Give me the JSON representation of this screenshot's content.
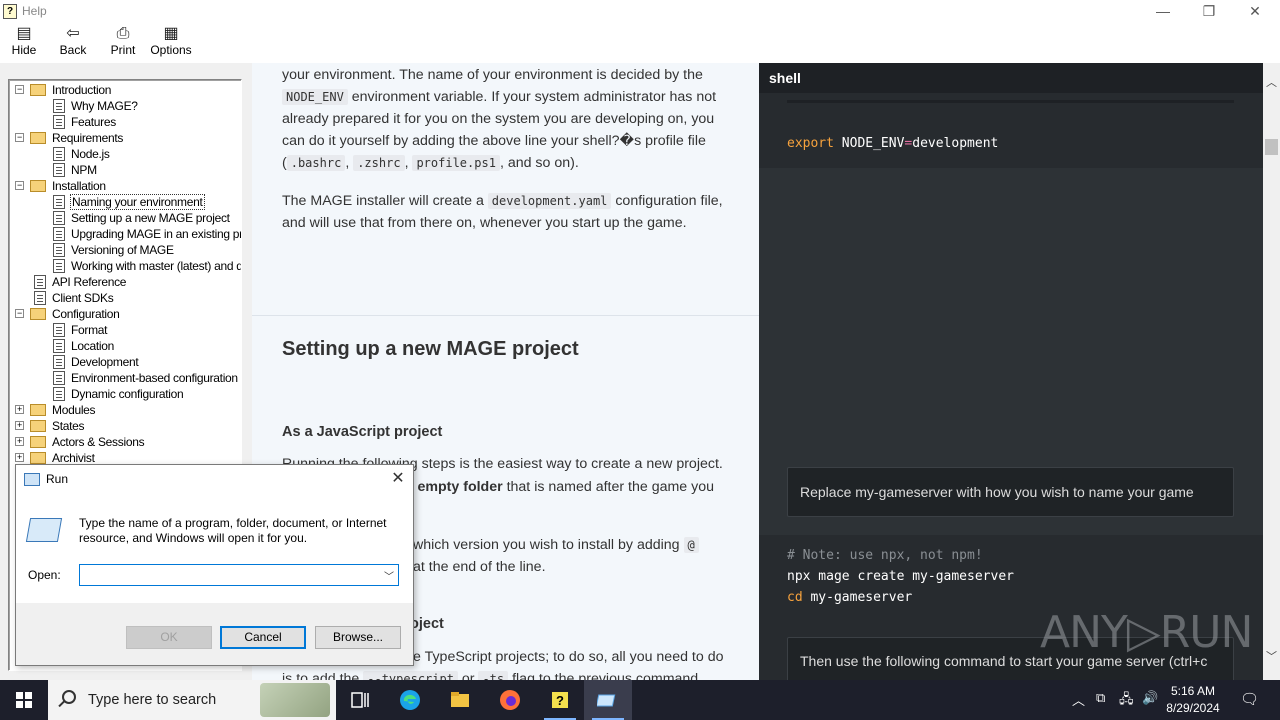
{
  "window": {
    "title": "Help",
    "minimize": "—",
    "maximize": "❐",
    "close": "✕"
  },
  "toolbar": {
    "hide": "Hide",
    "back": "Back",
    "print": "Print",
    "options": "Options"
  },
  "tree": [
    {
      "label": "Introduction",
      "kind": "folder",
      "level": 0,
      "expander": "−"
    },
    {
      "label": "Why MAGE?",
      "kind": "page",
      "level": 1
    },
    {
      "label": "Features",
      "kind": "page",
      "level": 1
    },
    {
      "label": "Requirements",
      "kind": "folder",
      "level": 0,
      "expander": "−"
    },
    {
      "label": "Node.js",
      "kind": "page",
      "level": 1
    },
    {
      "label": "NPM",
      "kind": "page",
      "level": 1
    },
    {
      "label": "Installation",
      "kind": "folder",
      "level": 0,
      "expander": "−"
    },
    {
      "label": "Naming your environment",
      "kind": "page",
      "level": 1,
      "selected": true
    },
    {
      "label": "Setting up a new MAGE project",
      "kind": "page",
      "level": 1
    },
    {
      "label": "Upgrading MAGE in an existing proj",
      "kind": "page",
      "level": 1
    },
    {
      "label": "Versioning of MAGE",
      "kind": "page",
      "level": 1
    },
    {
      "label": "Working with master (latest) and dev",
      "kind": "page",
      "level": 1
    },
    {
      "label": "API Reference",
      "kind": "page",
      "level": 0
    },
    {
      "label": "Client SDKs",
      "kind": "page",
      "level": 0
    },
    {
      "label": "Configuration",
      "kind": "folder",
      "level": 0,
      "expander": "−"
    },
    {
      "label": "Format",
      "kind": "page",
      "level": 1
    },
    {
      "label": "Location",
      "kind": "page",
      "level": 1
    },
    {
      "label": "Development",
      "kind": "page",
      "level": 1
    },
    {
      "label": "Environment-based configuration",
      "kind": "page",
      "level": 1
    },
    {
      "label": "Dynamic configuration",
      "kind": "page",
      "level": 1
    },
    {
      "label": "Modules",
      "kind": "folder",
      "level": 0,
      "expander": "+"
    },
    {
      "label": "States",
      "kind": "folder",
      "level": 0,
      "expander": "+"
    },
    {
      "label": "Actors & Sessions",
      "kind": "folder",
      "level": 0,
      "expander": "+"
    },
    {
      "label": "Archivist",
      "kind": "folder",
      "level": 0,
      "expander": "+"
    }
  ],
  "content": {
    "p1_a": "your environment. The name of your environment is decided by the",
    "p1_code1": "NODE_ENV",
    "p1_b": " environment variable. If your system administrator has not already prepared it for you on the system you are developing on, you can do it yourself by adding the above line your shell?�s profile file (",
    "p1_code2": ".bashrc",
    "p1_code3": ".zshrc",
    "p1_code4": "profile.ps1",
    "p1_c": ", and so on).",
    "p2_a": "The MAGE installer will create a ",
    "p2_code": "development.yaml",
    "p2_b": " configuration file, and will use that from there on, whenever you start up the game.",
    "h2": "Setting up a new MAGE project",
    "h3_js": "As a JavaScript project",
    "p3": "Running the following steps is the easiest way to create a new project.",
    "p4_bold": "an empty folder",
    "p4_rest": " that is named after the game you",
    "p5_a": "which version you wish to install by adding ",
    "p5_code": "@",
    "p5_b": "at the end of the line.",
    "h3_ts": "oject",
    "p6": "e TypeScript projects; to do so, all you need to do",
    "p7_a": "is to add the ",
    "p7_code1": "--typescript",
    "p7_mid": " or ",
    "p7_code2": "-ts",
    "p7_b": " flag to the previous command"
  },
  "code": {
    "tab": "shell",
    "line1_kw": "export",
    "line1_var": " NODE_ENV",
    "line1_op": "=",
    "line1_val": "development",
    "note1": "Replace my-gameserver with how you wish to name your game",
    "comment": "# Note: use npx, not npm!",
    "line2": "npx mage create my-gameserver",
    "line3_cmd": "cd",
    "line3_rest": " my-gameserver",
    "note2": "Then use the following command to start your game server (ctrl+c"
  },
  "watermark": "ANY▷RUN",
  "run_dialog": {
    "title": "Run",
    "description": "Type the name of a program, folder, document, or Internet resource, and Windows will open it for you.",
    "open_label": "Open:",
    "open_value": "",
    "ok": "OK",
    "cancel": "Cancel",
    "browse": "Browse..."
  },
  "taskbar": {
    "search_placeholder": "Type here to search",
    "time": "5:16 AM",
    "date": "8/29/2024"
  }
}
